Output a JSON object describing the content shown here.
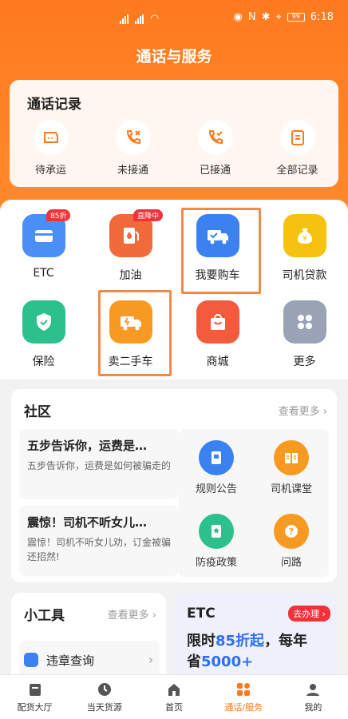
{
  "status": {
    "time": "6:18",
    "battery": "99"
  },
  "header": {
    "title": "通话与服务"
  },
  "call_records": {
    "title": "通话记录",
    "items": [
      {
        "label": "待承运",
        "icon": "waybill-icon"
      },
      {
        "label": "未接通",
        "icon": "missed-call-icon"
      },
      {
        "label": "已接通",
        "icon": "connected-call-icon"
      },
      {
        "label": "全部记录",
        "icon": "clipboard-icon"
      }
    ]
  },
  "services": {
    "items": [
      {
        "label": "ETC",
        "icon": "etc-card-icon",
        "badge": "85折",
        "color": "#4a8ff5"
      },
      {
        "label": "加油",
        "icon": "fuel-icon",
        "badge": "直降中",
        "color": "#f06a3a"
      },
      {
        "label": "我要购车",
        "icon": "truck-buy-icon",
        "color": "#3b82f0"
      },
      {
        "label": "司机贷款",
        "icon": "money-bag-icon",
        "color": "#f5c20f"
      },
      {
        "label": "保险",
        "icon": "shield-icon",
        "color": "#2cc08c"
      },
      {
        "label": "卖二手车",
        "icon": "truck-sell-icon",
        "color": "#f89a22"
      },
      {
        "label": "商城",
        "icon": "shopping-bag-icon",
        "color": "#f45a3c"
      },
      {
        "label": "更多",
        "icon": "grid-more-icon",
        "color": "#9aa3b6"
      }
    ]
  },
  "community": {
    "title": "社区",
    "more": "查看更多",
    "news": [
      {
        "title": "五步告诉你，运费是…",
        "summary": "五步告诉你，运费是如何被骗走的"
      },
      {
        "title": "震惊！司机不听女儿…",
        "summary": "震惊！司机不听女儿劝，订金被骗还招然!"
      }
    ],
    "items": [
      {
        "label": "规则公告",
        "icon": "notice-icon",
        "color": "#3b82f0"
      },
      {
        "label": "司机课堂",
        "icon": "book-icon",
        "color": "#f89a22"
      },
      {
        "label": "防疫政策",
        "icon": "policy-icon",
        "color": "#2cc08c"
      },
      {
        "label": "问路",
        "icon": "question-icon",
        "color": "#f89a22"
      }
    ]
  },
  "tools": {
    "title": "小工具",
    "more": "查看更多",
    "item": "违章查询"
  },
  "etc_promo": {
    "title": "ETC",
    "action": "去办理",
    "line1_a": "限时",
    "line1_b": "85折起",
    "line1_c": "，每年",
    "line2_a": "省",
    "line2_b": "5000+"
  },
  "tabbar": {
    "items": [
      {
        "label": "配货大厅",
        "icon": "hall-icon"
      },
      {
        "label": "当天货源",
        "icon": "clock-icon"
      },
      {
        "label": "首页",
        "icon": "home-icon"
      },
      {
        "label": "通话/服务",
        "icon": "service-icon",
        "active": true
      },
      {
        "label": "我的",
        "icon": "user-icon"
      }
    ]
  }
}
